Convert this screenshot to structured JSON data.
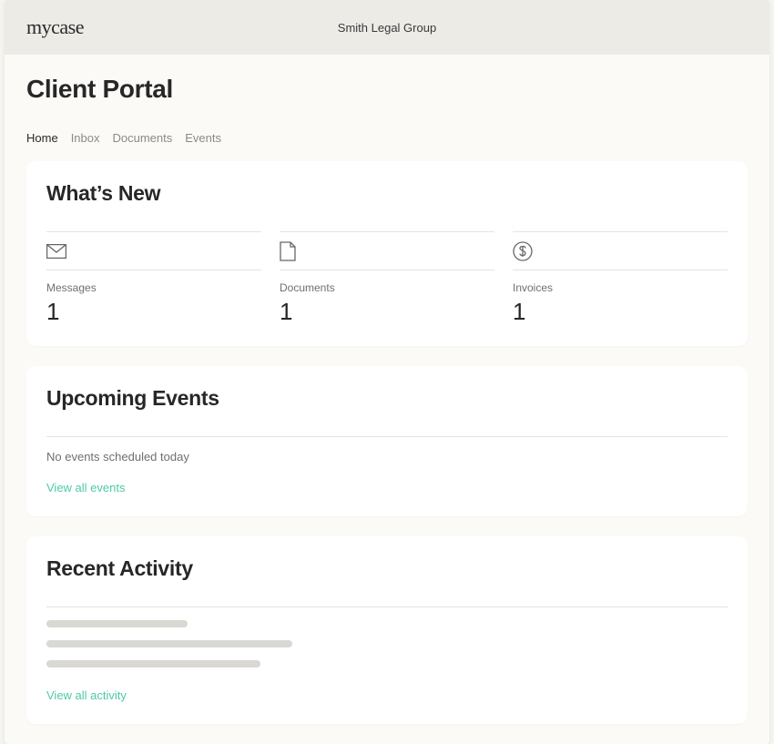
{
  "header": {
    "logo": "mycase",
    "firm": "Smith Legal Group"
  },
  "page_title": "Client Portal",
  "tabs": {
    "home": "Home",
    "inbox": "Inbox",
    "documents": "Documents",
    "events": "Events"
  },
  "whats_new": {
    "title": "What’s New",
    "messages": {
      "label": "Messages",
      "count": "1"
    },
    "documents": {
      "label": "Documents",
      "count": "1"
    },
    "invoices": {
      "label": "Invoices",
      "count": "1"
    }
  },
  "upcoming": {
    "title": "Upcoming Events",
    "empty": "No events scheduled today",
    "link": "View all events"
  },
  "recent": {
    "title": "Recent Activity",
    "link": "View all activity"
  }
}
